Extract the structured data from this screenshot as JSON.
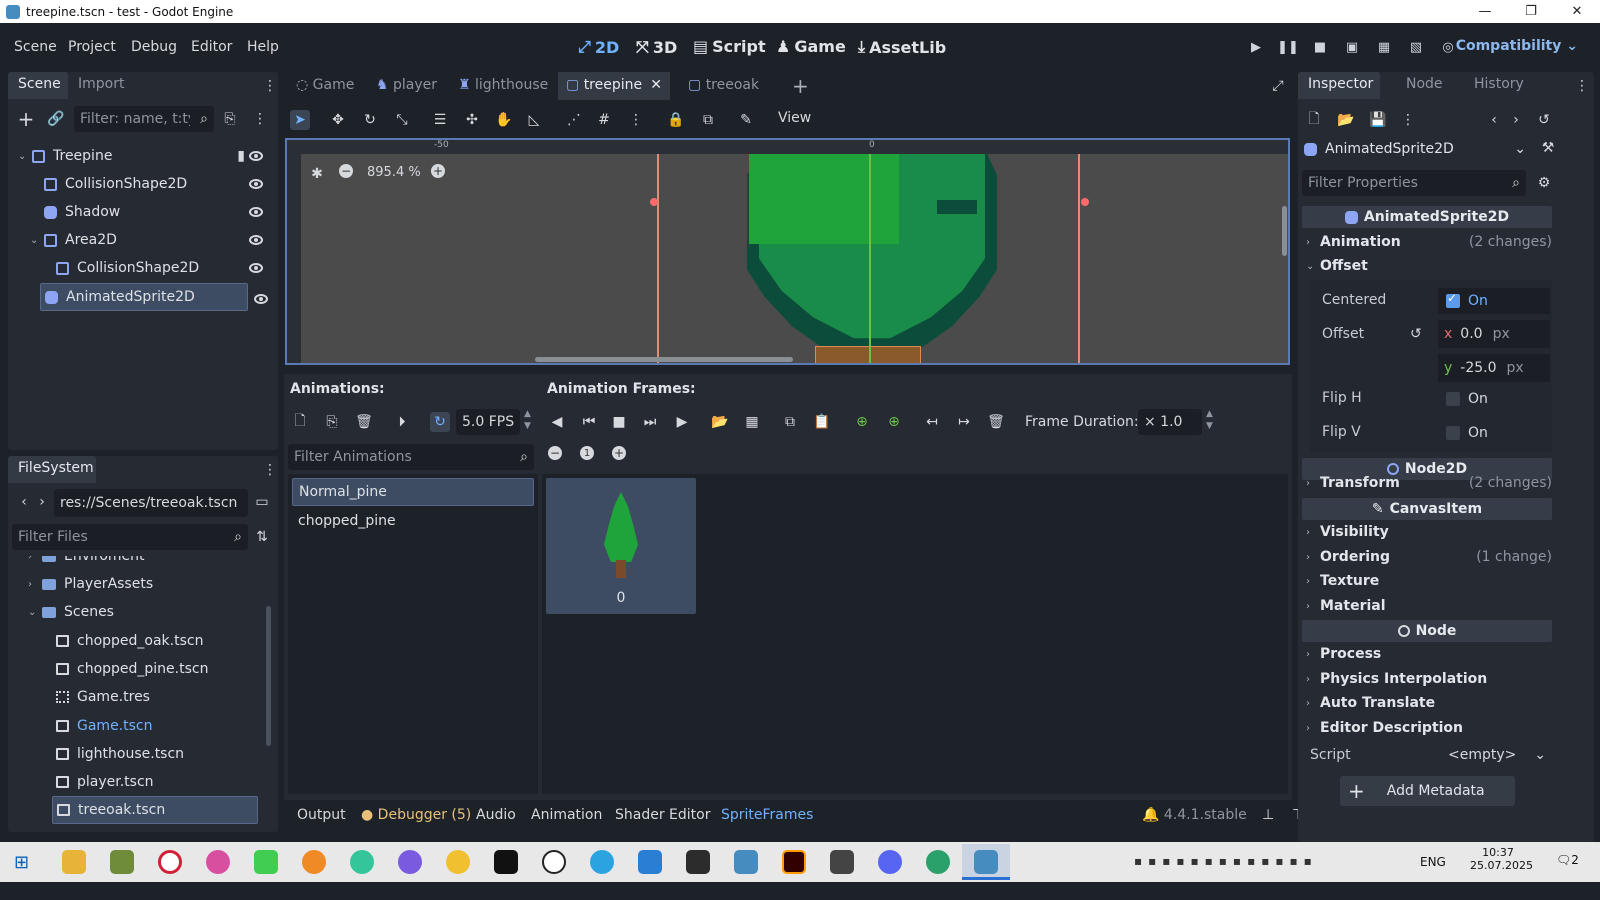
{
  "window": {
    "title": "treepine.tscn - test - Godot Engine",
    "minimize": "—",
    "maximize": "❐",
    "close": "✕"
  },
  "menu": [
    "Scene",
    "Project",
    "Debug",
    "Editor",
    "Help"
  ],
  "workspaces": [
    {
      "label": "2D",
      "icon": "2d-icon"
    },
    {
      "label": "3D",
      "icon": "3d-icon"
    },
    {
      "label": "Script",
      "icon": "script-icon"
    },
    {
      "label": "Game",
      "icon": "game-icon"
    },
    {
      "label": "AssetLib",
      "icon": "assetlib-icon"
    }
  ],
  "renderer": "Compatibility",
  "scene_dock": {
    "tabs": [
      "Scene",
      "Import"
    ],
    "filter_placeholder": "Filter: name, t:typ",
    "tree": [
      {
        "label": "Treepine",
        "depth": 0
      },
      {
        "label": "CollisionShape2D",
        "depth": 1
      },
      {
        "label": "Shadow",
        "depth": 1
      },
      {
        "label": "Area2D",
        "depth": 1
      },
      {
        "label": "CollisionShape2D",
        "depth": 2
      },
      {
        "label": "AnimatedSprite2D",
        "depth": 1
      }
    ]
  },
  "filesystem": {
    "tab": "FileSystem",
    "path": "res://Scenes/treeoak.tscn",
    "filter_placeholder": "Filter Files",
    "items": [
      {
        "label": "Enviroment",
        "type": "folder"
      },
      {
        "label": "PlayerAssets",
        "type": "folder"
      },
      {
        "label": "Scenes",
        "type": "folder"
      },
      {
        "label": "chopped_oak.tscn",
        "type": "file"
      },
      {
        "label": "chopped_pine.tscn",
        "type": "file"
      },
      {
        "label": "Game.tres",
        "type": "file"
      },
      {
        "label": "Game.tscn",
        "type": "file"
      },
      {
        "label": "lighthouse.tscn",
        "type": "file"
      },
      {
        "label": "player.tscn",
        "type": "file"
      },
      {
        "label": "treeoak.tscn",
        "type": "file"
      }
    ]
  },
  "editor_tabs": [
    "Game",
    "player",
    "lighthouse",
    "treepine",
    "treeoak"
  ],
  "toolbar": {
    "view": "View"
  },
  "viewport": {
    "zoom": "895.4 %",
    "ruler_minus50": "-50",
    "ruler_0": "0"
  },
  "animation_panel": {
    "animations_label": "Animations:",
    "frames_label": "Animation Frames:",
    "fps": "5.0 FPS",
    "frame_duration_label": "Frame Duration:",
    "frame_duration": "× 1.0",
    "filter_placeholder": "Filter Animations",
    "animations": [
      "Normal_pine",
      "chopped_pine"
    ],
    "frames": [
      {
        "index": "0"
      }
    ]
  },
  "inspector": {
    "tabs": [
      "Inspector",
      "Node",
      "History"
    ],
    "node_type": "AnimatedSprite2D",
    "filter_placeholder": "Filter Properties",
    "class_header": "AnimatedSprite2D",
    "animation_label": "Animation",
    "animation_changes": "(2 changes)",
    "offset_section": "Offset",
    "centered_label": "Centered",
    "centered_value": "On",
    "offset_label": "Offset",
    "offset_x_axis": "x",
    "offset_x": "0.0",
    "offset_y_axis": "y",
    "offset_y": "-25.0",
    "unit": "px",
    "flip_h_label": "Flip H",
    "flip_h_value": "On",
    "flip_v_label": "Flip V",
    "flip_v_value": "On",
    "node2d_header": "Node2D",
    "transform_label": "Transform",
    "transform_changes": "(2 changes)",
    "canvasitem_header": "CanvasItem",
    "visibility_label": "Visibility",
    "ordering_label": "Ordering",
    "ordering_changes": "(1 change)",
    "texture_label": "Texture",
    "material_label": "Material",
    "node_header": "Node",
    "process_label": "Process",
    "physics_label": "Physics Interpolation",
    "autotranslate_label": "Auto Translate",
    "editordesc_label": "Editor Description",
    "script_label": "Script",
    "script_value": "<empty>",
    "add_metadata": "Add Metadata"
  },
  "bottom_tabs": [
    "Output",
    "Debugger (5)",
    "Audio",
    "Animation",
    "Shader Editor",
    "SpriteFrames"
  ],
  "version": "4.4.1.stable",
  "taskbar": {
    "lang": "ENG",
    "time": "10:37",
    "date": "25.07.2025",
    "notif": "2"
  },
  "colors": {
    "accent": "#71b2ff",
    "panel": "#262b33",
    "background": "#1d2229",
    "leaf_light": "#1fa43c",
    "leaf_dark": "#0c4c3a"
  }
}
